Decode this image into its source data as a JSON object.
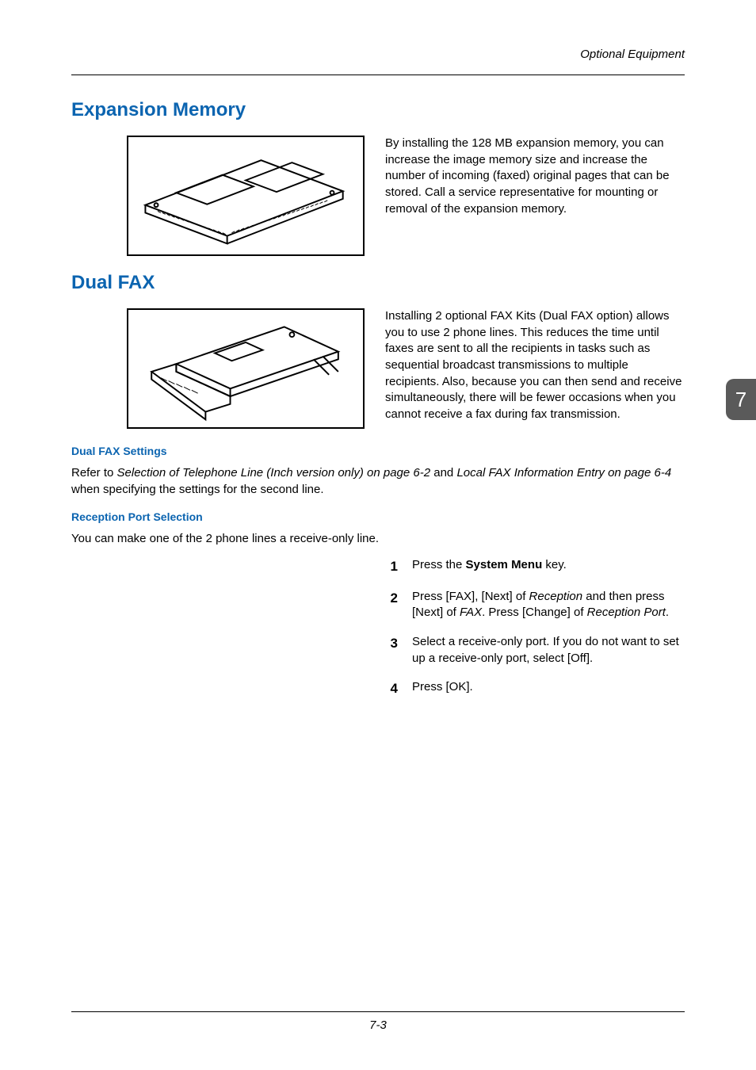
{
  "header": {
    "section": "Optional Equipment"
  },
  "sidetab": {
    "chapter": "7"
  },
  "footer": {
    "page": "7-3"
  },
  "sections": {
    "expansion": {
      "title": "Expansion Memory",
      "body": "By installing the 128 MB expansion memory, you can increase the image memory size and increase the number of incoming (faxed) original pages that can be stored. Call a service representative for mounting or removal of the expansion memory."
    },
    "dualfax": {
      "title": "Dual FAX",
      "body": "Installing 2 optional FAX Kits (Dual FAX option) allows you to use 2 phone lines. This reduces the time until faxes are sent to all the recipients in tasks such as sequential broadcast transmissions to multiple recipients. Also, because you can then send and receive simultaneously, there will be fewer occasions when you cannot receive a fax during fax transmission.",
      "settings": {
        "title": "Dual FAX Settings",
        "refer_pre": "Refer to ",
        "refer_i1": "Selection of Telephone Line (Inch version only) on page 6-2",
        "refer_mid": " and ",
        "refer_i2": "Local FAX Information Entry on page 6-4",
        "refer_post": " when specifying the settings for the second line."
      },
      "reception": {
        "title": "Reception Port Selection",
        "intro": "You can make one of the 2 phone lines a receive-only line.",
        "steps": {
          "1": {
            "num": "1",
            "pre": "Press the ",
            "bold": "System Menu",
            "post": " key."
          },
          "2": {
            "num": "2",
            "p1": "Press [FAX], [Next] of ",
            "i1": "Reception",
            "p2": " and then press [Next] of ",
            "i2": "FAX",
            "p3": ". Press [Change] of ",
            "i3": "Reception Port",
            "p4": "."
          },
          "3": {
            "num": "3",
            "text": "Select a receive-only port. If you do not want to set up a receive-only port, select [Off]."
          },
          "4": {
            "num": "4",
            "text": "Press [OK]."
          }
        }
      }
    }
  }
}
